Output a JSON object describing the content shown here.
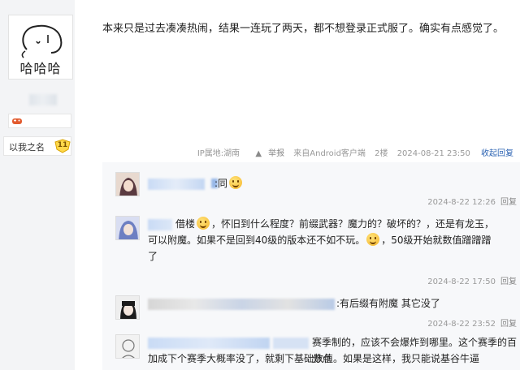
{
  "user": {
    "avatar_text": "哈哈哈",
    "rank_label": "以我之名",
    "level": "11"
  },
  "post": {
    "body": "本来只是过去凑凑热闹，结果一连玩了两天，都不想登录正式服了。确实有点感觉了。",
    "ip_location": "IP属地:湖南",
    "report_label": "举报",
    "source": "来自Android客户端",
    "floor": "2楼",
    "time": "2024-08-21 23:50",
    "collapse_label": "收起回复"
  },
  "replies": [
    {
      "text": ":同",
      "time": "2024-8-22 12:26",
      "reply_label": "回复"
    },
    {
      "lines": [
        "借楼",
        "，怀旧到什么程度？前缀武器？魔力的？破坏的？，还是有龙玉，",
        "可以附魔。如果不是回到40级的版本还不如不玩。",
        "，50级开始就数值蹭蹭蹭",
        "了"
      ],
      "time": "2024-8-22 17:50",
      "reply_label": "回复"
    },
    {
      "text": ":有后缀有附魔 其它没了",
      "time": "2024-8-22 23:52",
      "reply_label": "回复"
    },
    {
      "lines": [
        "赛季制的，应该不会爆炸到哪里。这个赛季的百分点",
        "加成下个赛季大概率没了，就剩下基础数值。如果是这样，我只能说基谷牛逼"
      ]
    }
  ],
  "colors": {
    "link": "#2d64b3",
    "meta": "#999999",
    "reply_bg": "#f7f8fa"
  }
}
